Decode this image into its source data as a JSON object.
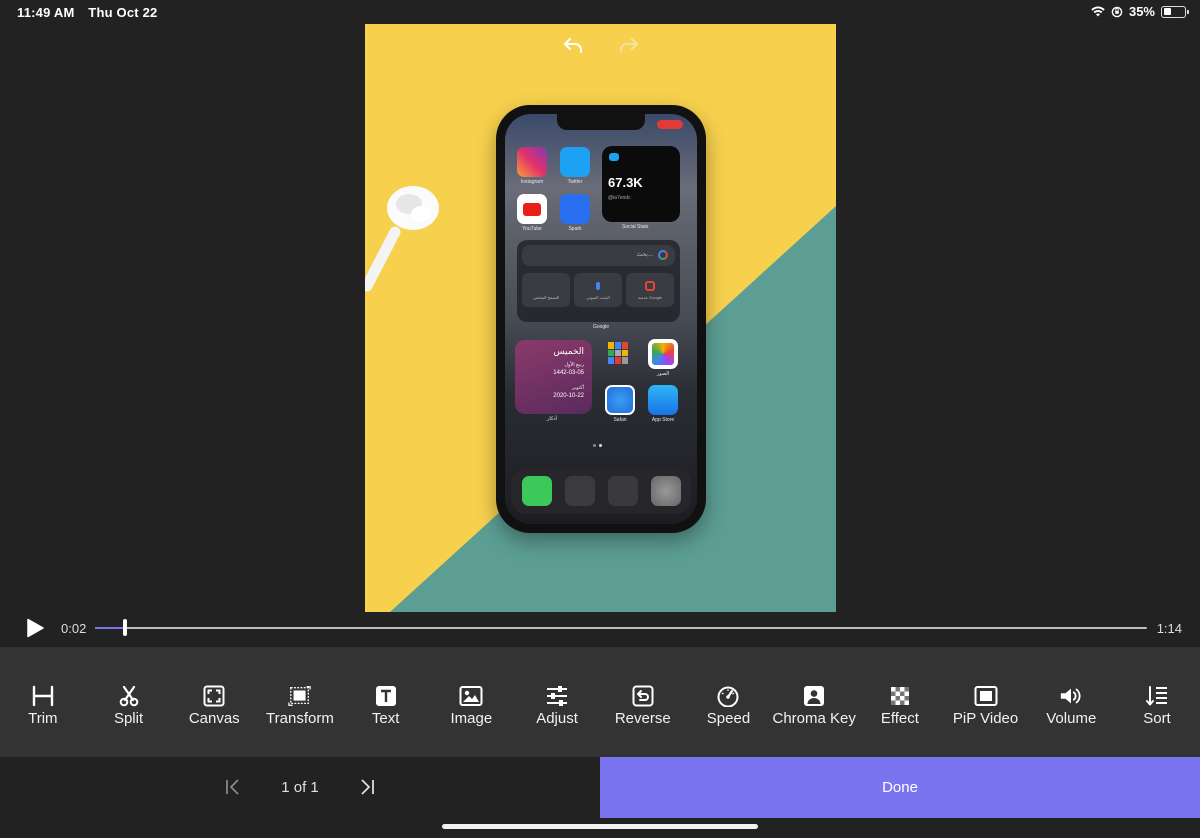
{
  "status_bar": {
    "time": "11:49 AM",
    "date": "Thu Oct 22",
    "battery_percent": "35%",
    "battery_level": 0.35
  },
  "preview": {
    "phone_apps": {
      "instagram": "Instagram",
      "twitter": "Twitter",
      "youtube": "YouTube",
      "spark": "Spark",
      "social_stats_value": "67.3K",
      "social_stats_handle": "@ia7endc",
      "social_stats_label": "Social Stats",
      "google_search_placeholder": "بحث...",
      "google_label": "Google",
      "google_btn_1": "التصفح المتخفي",
      "google_btn_2": "البحث الصوتي",
      "google_btn_3": "عدسة Google",
      "calendar_day": "الخميس",
      "calendar_hijri_month": "ربيع الأول",
      "calendar_hijri_date": "1442-03-05",
      "calendar_greg_month": "أكتوبر",
      "calendar_greg_date": "2020-10-22",
      "calendar_label": "أذكار",
      "photos": "الصور",
      "safari": "Safari",
      "app_store": "App Store"
    },
    "colors": {
      "yellow": "#f7d14d",
      "teal": "#5c9e94"
    }
  },
  "playback": {
    "current_time": "0:02",
    "total_time": "1:14",
    "progress": 0.027,
    "accent": "#7b74f0"
  },
  "toolbar": {
    "items": [
      {
        "label": "Trim",
        "icon": "trim-icon"
      },
      {
        "label": "Split",
        "icon": "scissors-icon"
      },
      {
        "label": "Canvas",
        "icon": "canvas-icon"
      },
      {
        "label": "Transform",
        "icon": "transform-icon"
      },
      {
        "label": "Text",
        "icon": "text-icon"
      },
      {
        "label": "Image",
        "icon": "image-icon"
      },
      {
        "label": "Adjust",
        "icon": "sliders-icon"
      },
      {
        "label": "Reverse",
        "icon": "reverse-icon"
      },
      {
        "label": "Speed",
        "icon": "speedometer-icon"
      },
      {
        "label": "Chroma Key",
        "icon": "chroma-key-icon"
      },
      {
        "label": "Effect",
        "icon": "checkerboard-icon"
      },
      {
        "label": "PiP Video",
        "icon": "pip-icon"
      },
      {
        "label": "Volume",
        "icon": "speaker-icon"
      },
      {
        "label": "Sort",
        "icon": "sort-icon"
      }
    ]
  },
  "bottom": {
    "page_text": "1 of 1",
    "done_label": "Done"
  }
}
